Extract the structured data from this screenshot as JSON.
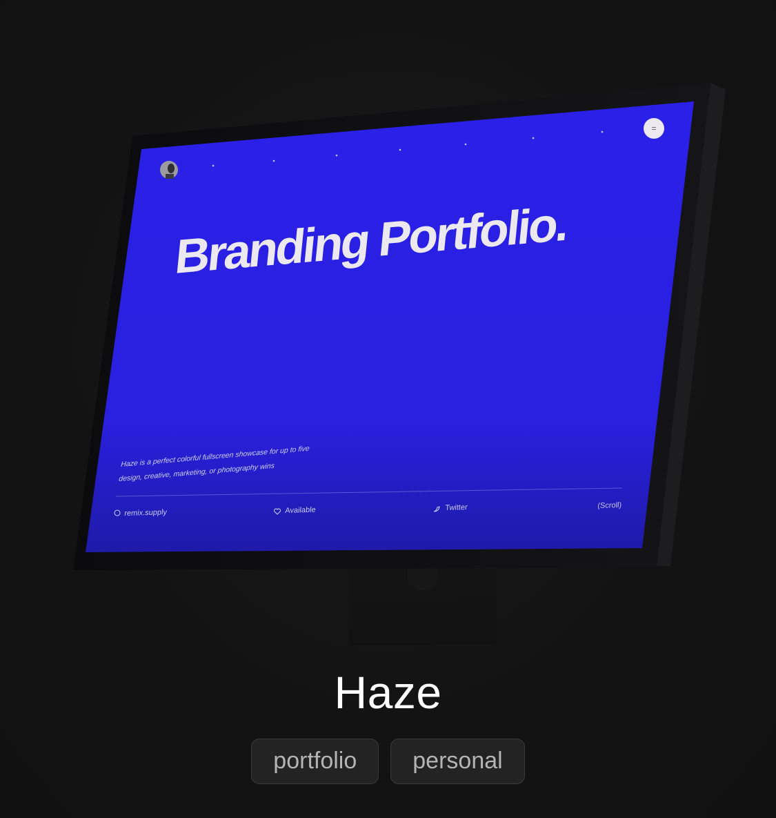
{
  "screen": {
    "menu_glyph": "=",
    "headline": "Branding Portfolio.",
    "description_line1": "Haze is a perfect colorful fullscreen showcase for up to five",
    "description_line2": "design, creative, marketing, or photography wins",
    "footer": {
      "site": "remix.supply",
      "status": "Available",
      "social": "Twitter",
      "scroll": "(Scroll)"
    },
    "colors": {
      "screen_blue": "#2a20e6",
      "headline": "#ece8ef"
    }
  },
  "card": {
    "title": "Haze",
    "tags": [
      "portfolio",
      "personal"
    ]
  },
  "icons": [
    "avatar",
    "menu-icon",
    "remix-icon",
    "heart-icon",
    "twitter-icon"
  ]
}
